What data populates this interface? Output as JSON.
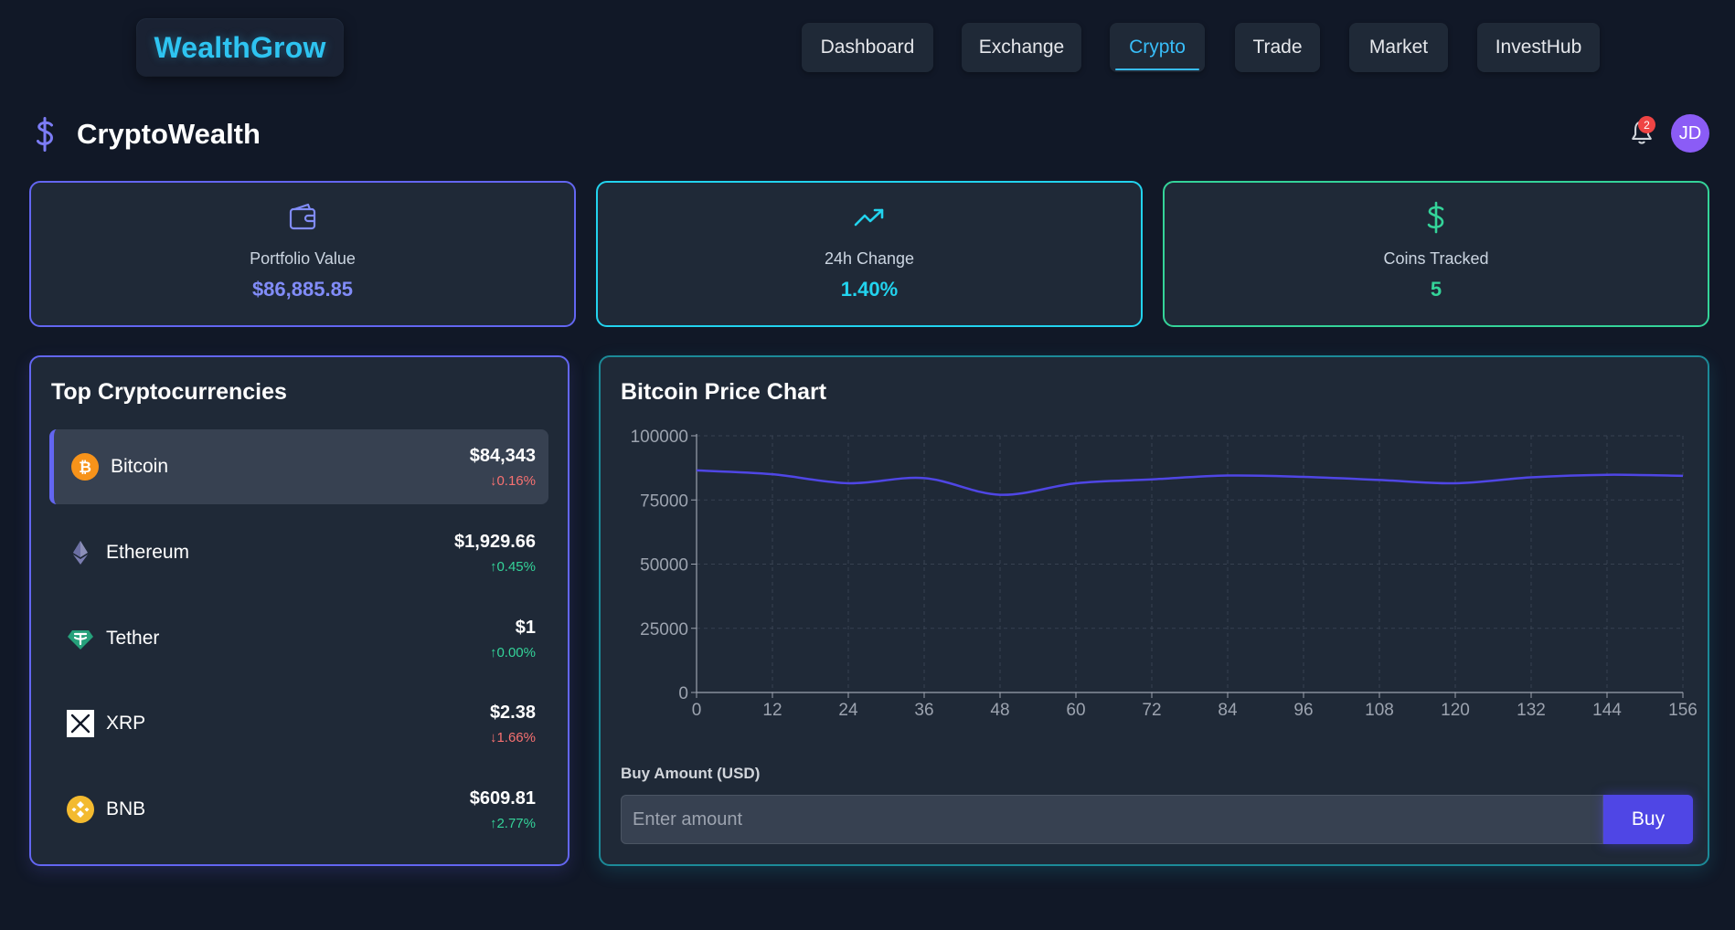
{
  "header": {
    "logo": "WealthGrow",
    "nav": [
      {
        "label": "Dashboard",
        "active": false
      },
      {
        "label": "Exchange",
        "active": false
      },
      {
        "label": "Crypto",
        "active": true
      },
      {
        "label": "Trade",
        "active": false
      },
      {
        "label": "Market",
        "active": false
      },
      {
        "label": "InvestHub",
        "active": false
      }
    ]
  },
  "page": {
    "title": "CryptoWealth",
    "notifications_count": "2",
    "avatar_initials": "JD"
  },
  "stats": [
    {
      "icon": "wallet-icon",
      "label": "Portfolio Value",
      "value": "$86,885.85",
      "color": "#818cf8"
    },
    {
      "icon": "trending-up-icon",
      "label": "24h Change",
      "value": "1.40%",
      "color": "#22d3ee"
    },
    {
      "icon": "dollar-icon",
      "label": "Coins Tracked",
      "value": "5",
      "color": "#34d399"
    }
  ],
  "top_coins": {
    "title": "Top Cryptocurrencies",
    "items": [
      {
        "name": "Bitcoin",
        "icon": "bitcoin-icon",
        "price": "$84,343",
        "change": "0.16%",
        "direction": "down",
        "selected": true
      },
      {
        "name": "Ethereum",
        "icon": "ethereum-icon",
        "price": "$1,929.66",
        "change": "0.45%",
        "direction": "up",
        "selected": false
      },
      {
        "name": "Tether",
        "icon": "tether-icon",
        "price": "$1",
        "change": "0.00%",
        "direction": "up",
        "selected": false
      },
      {
        "name": "XRP",
        "icon": "xrp-icon",
        "price": "$2.38",
        "change": "1.66%",
        "direction": "down",
        "selected": false
      },
      {
        "name": "BNB",
        "icon": "bnb-icon",
        "price": "$609.81",
        "change": "2.77%",
        "direction": "up",
        "selected": false
      }
    ]
  },
  "price_chart": {
    "title": "Bitcoin Price Chart"
  },
  "buy": {
    "label": "Buy Amount (USD)",
    "placeholder": "Enter amount",
    "button": "Buy"
  },
  "colors": {
    "background": "#111827",
    "panel": "#1f2937",
    "accent_indigo": "#6366f1",
    "accent_cyan": "#22d3ee",
    "accent_green": "#34d399",
    "down": "#f87171",
    "up": "#34d399"
  },
  "chart_data": {
    "type": "line",
    "title": "",
    "xlabel": "",
    "ylabel": "",
    "x": [
      0,
      12,
      24,
      36,
      48,
      60,
      72,
      84,
      96,
      108,
      120,
      132,
      144,
      156
    ],
    "series": [
      {
        "values": [
          86500,
          85000,
          81500,
          83500,
          77000,
          81500,
          83000,
          84500,
          84000,
          82800,
          81500,
          83800,
          84800,
          84400
        ]
      }
    ],
    "xlim": [
      0,
      156
    ],
    "ylim": [
      0,
      100000
    ],
    "x_ticks": [
      0,
      12,
      24,
      36,
      48,
      60,
      72,
      84,
      96,
      108,
      120,
      132,
      144,
      156
    ],
    "y_ticks": [
      0,
      25000,
      50000,
      75000,
      100000
    ],
    "grid": true,
    "line_color": "#4f46e5"
  }
}
